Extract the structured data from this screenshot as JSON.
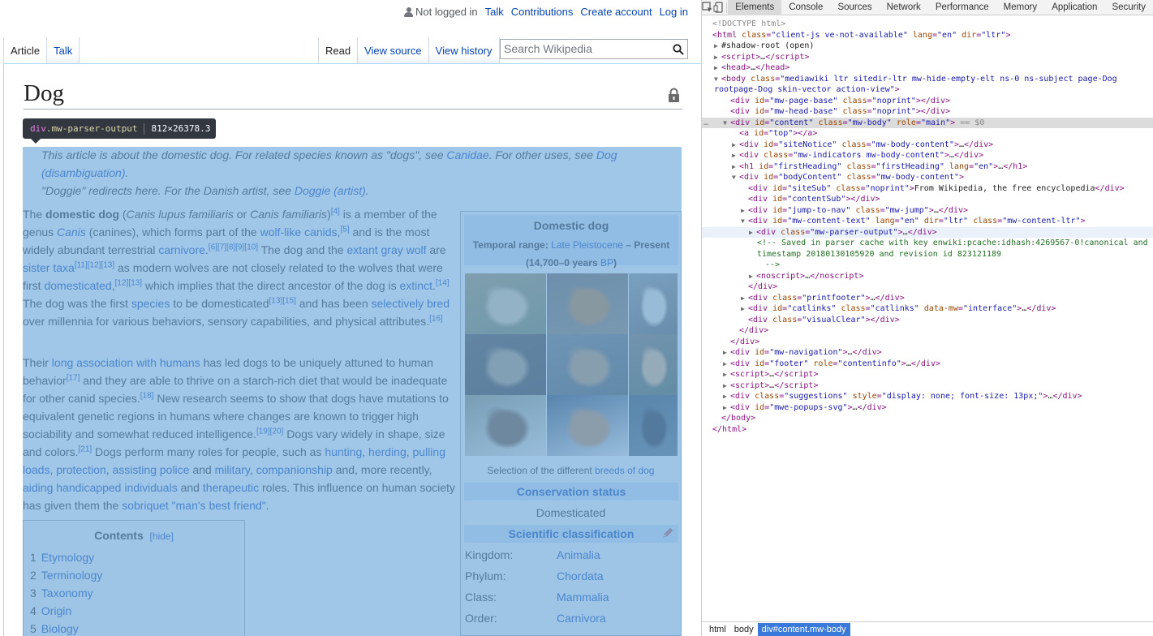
{
  "personal": {
    "status": "Not logged in",
    "links": [
      "Talk",
      "Contributions",
      "Create account",
      "Log in"
    ]
  },
  "tabs_left": [
    "Article",
    "Talk"
  ],
  "tabs_right": [
    "Read",
    "View source",
    "View history"
  ],
  "search": {
    "placeholder": "Search Wikipedia"
  },
  "page": {
    "title": "Dog"
  },
  "tooltip": {
    "tag": "div",
    "class": ".mw-parser-output",
    "size": "812×26378.3"
  },
  "hatnotes": [
    {
      "before": "This article is about the domestic dog. For related species known as \"dogs\", see ",
      "link1": "Canidae",
      "mid": ". For other uses, see ",
      "link2": "Dog (disambiguation)",
      "after": "."
    },
    {
      "before": "\"Doggie\" redirects here. For the Danish artist, see ",
      "link1": "Doggie (artist)",
      "after": "."
    }
  ],
  "infobox": {
    "title": "Domestic dog",
    "temporal_label": "Temporal range:",
    "temporal_link": "Late Pleistocene",
    "temporal_rest": " – Present",
    "temporal_years": "(14,700–0 years ",
    "temporal_bp": "BP",
    "temporal_close": ")",
    "caption_text": "Selection of the different ",
    "caption_link": "breeds of dog",
    "conservation_header": "Conservation status",
    "conservation_value": "Domesticated",
    "classification_header": "Scientific classification",
    "rows": [
      {
        "key": "Kingdom:",
        "value": "Animalia"
      },
      {
        "key": "Phylum:",
        "value": "Chordata"
      },
      {
        "key": "Class:",
        "value": "Mammalia"
      },
      {
        "key": "Order:",
        "value": "Carnivora"
      }
    ],
    "images": [
      {
        "name": "golden-puppy",
        "colors": [
          "#a08c5a",
          "#d9c49a",
          "#6f7a4a"
        ]
      },
      {
        "name": "golden-retriever",
        "colors": [
          "#6b5f4f",
          "#b8782f",
          "#8a7a5e"
        ]
      },
      {
        "name": "white-terrier",
        "colors": [
          "#8f8f88",
          "#e8e0cc",
          "#5e5a52"
        ]
      },
      {
        "name": "yorkshire-terrier",
        "colors": [
          "#4b4136",
          "#a48e6a",
          "#3a322a"
        ]
      },
      {
        "name": "boxer",
        "colors": [
          "#6d6f6a",
          "#b58a5a",
          "#4d4f48"
        ]
      },
      {
        "name": "pomeranian",
        "colors": [
          "#7a6a54",
          "#e2b07a",
          "#4b5a3c"
        ]
      },
      {
        "name": "beagle",
        "colors": [
          "#8b8a6a",
          "#6a4a2a",
          "#e8e4d8"
        ]
      },
      {
        "name": "basset-hound",
        "colors": [
          "#2f3e52",
          "#c0854a",
          "#e8e4dc"
        ]
      },
      {
        "name": "newfoundland",
        "colors": [
          "#31434f",
          "#1e1e22",
          "#5a6a72"
        ]
      }
    ]
  },
  "toc": {
    "title": "Contents",
    "toggle": "[hide]",
    "items": [
      {
        "num": "1",
        "label": "Etymology"
      },
      {
        "num": "2",
        "label": "Terminology"
      },
      {
        "num": "3",
        "label": "Taxonomy"
      },
      {
        "num": "4",
        "label": "Origin"
      },
      {
        "num": "5",
        "label": "Biology"
      }
    ]
  },
  "devtools": {
    "tabs": [
      "Elements",
      "Console",
      "Sources",
      "Network",
      "Performance",
      "Memory",
      "Application",
      "Security"
    ],
    "breadcrumbs": [
      "html",
      "body",
      "div#content.mw-body"
    ]
  }
}
